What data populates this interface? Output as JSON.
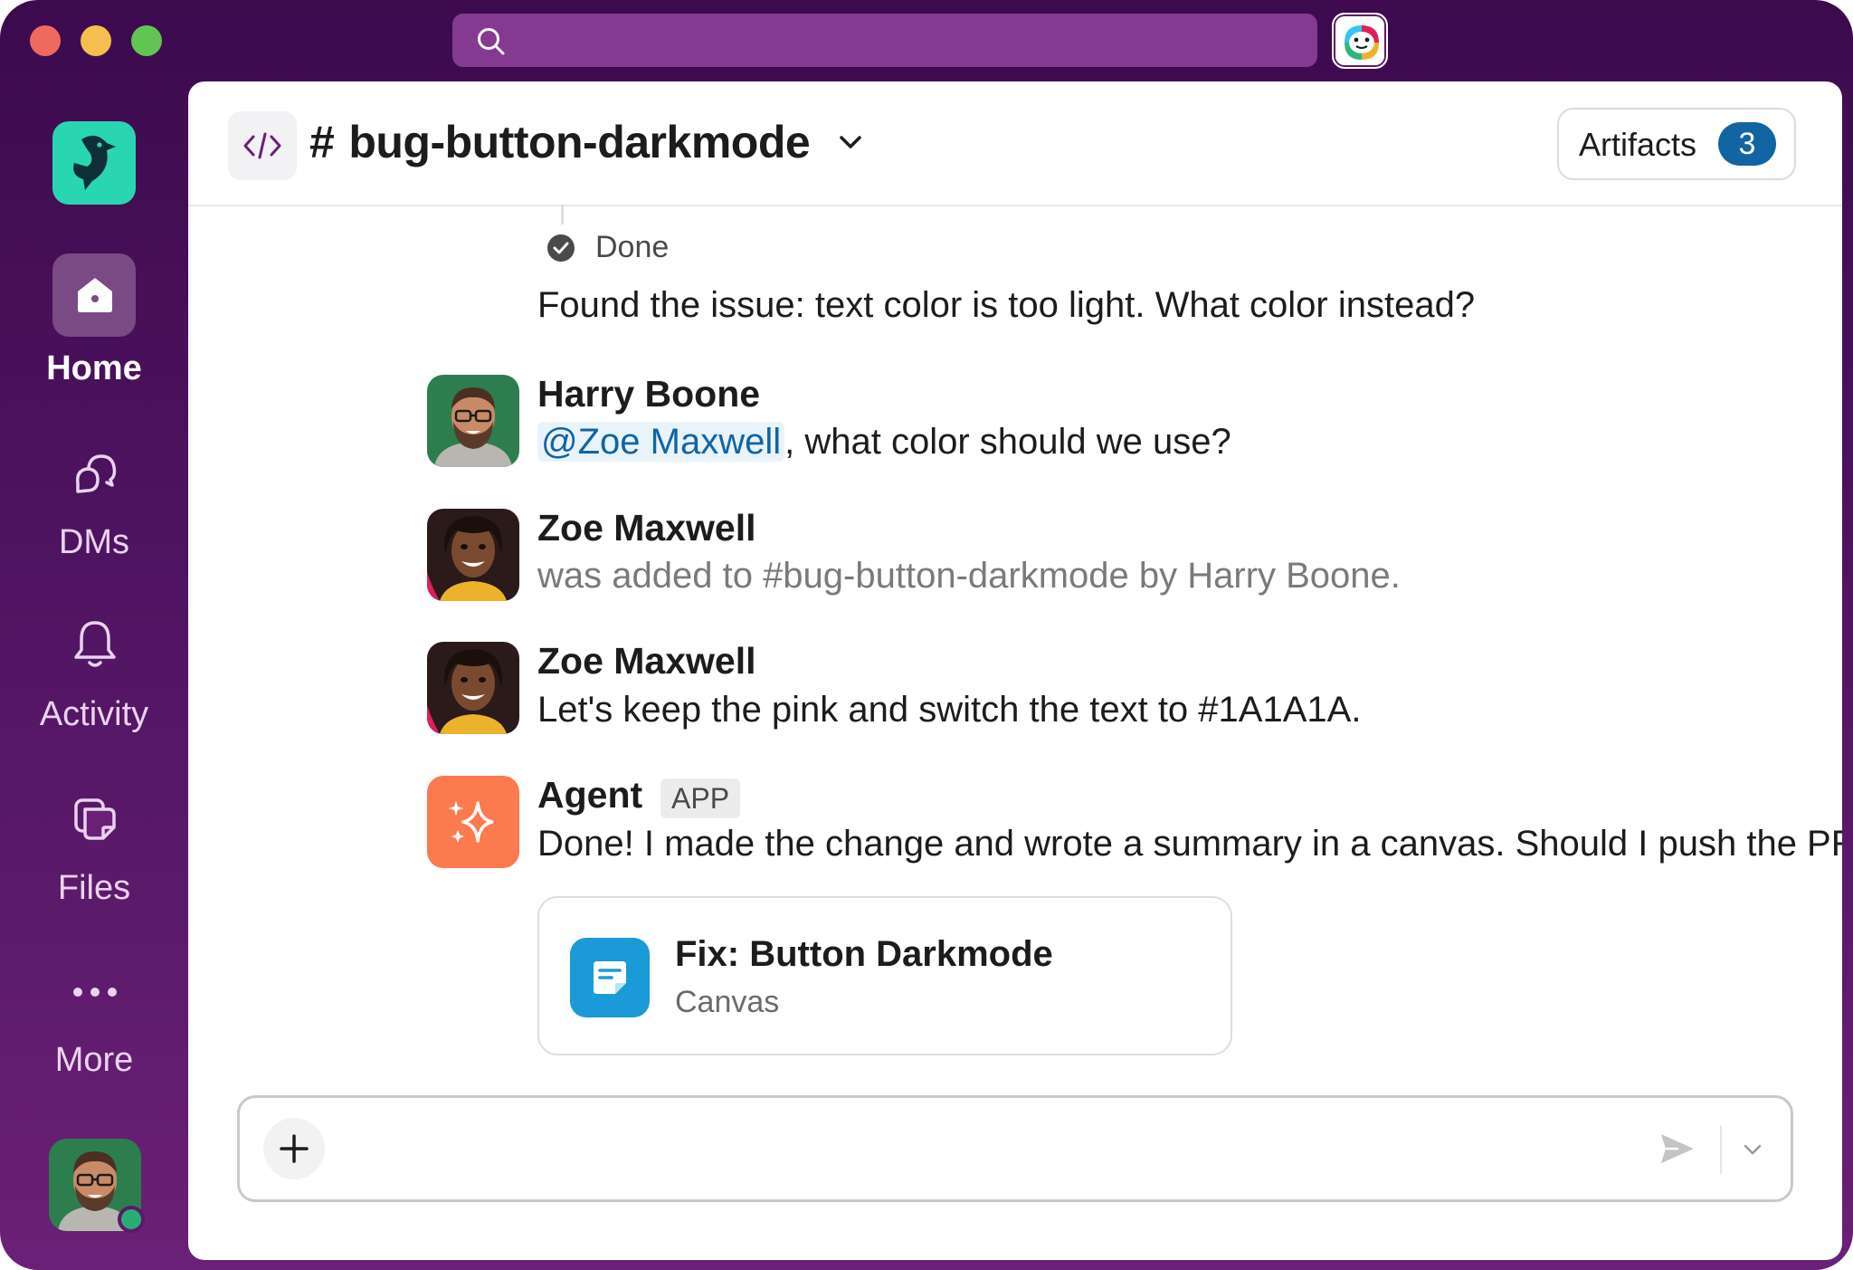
{
  "colors": {
    "sidebar_gradient_top": "#3d0a4e",
    "sidebar_gradient_bottom": "#6a2076",
    "search_bg": "#853a91",
    "workspace_icon": "#2ad5b2",
    "mention": "#1264a3",
    "badge": "#1264a3",
    "agent_avatar": "#fc7a4e",
    "canvas_icon": "#1a9ad6",
    "presence": "#2bac76"
  },
  "sidebar": {
    "items": [
      {
        "label": "Home",
        "icon": "home-icon",
        "active": true
      },
      {
        "label": "DMs",
        "icon": "dms-icon",
        "active": false
      },
      {
        "label": "Activity",
        "icon": "bell-icon",
        "active": false
      },
      {
        "label": "Files",
        "icon": "files-icon",
        "active": false
      },
      {
        "label": "More",
        "icon": "more-icon",
        "active": false
      }
    ]
  },
  "header": {
    "hash": "#",
    "channel_name": "bug-button-darkmode",
    "artifacts_label": "Artifacts",
    "artifacts_count": "3"
  },
  "messages": {
    "done_label": "Done",
    "prev_text": "Found the issue: text color is too light. What color instead?",
    "m1": {
      "author": "Harry Boone",
      "mention": "@Zoe Maxwell",
      "text": ", what color should we use?"
    },
    "m2": {
      "author": "Zoe Maxwell",
      "text": "was added to #bug-button-darkmode by Harry Boone."
    },
    "m3": {
      "author": "Zoe Maxwell",
      "text": "Let's keep the pink and switch the text to #1A1A1A."
    },
    "m4": {
      "author": "Agent",
      "badge": "APP",
      "text": "Done! I made the change and wrote a summary in a canvas. Should I push the PR?"
    }
  },
  "canvas": {
    "title": "Fix: Button Darkmode",
    "subtitle": "Canvas"
  }
}
